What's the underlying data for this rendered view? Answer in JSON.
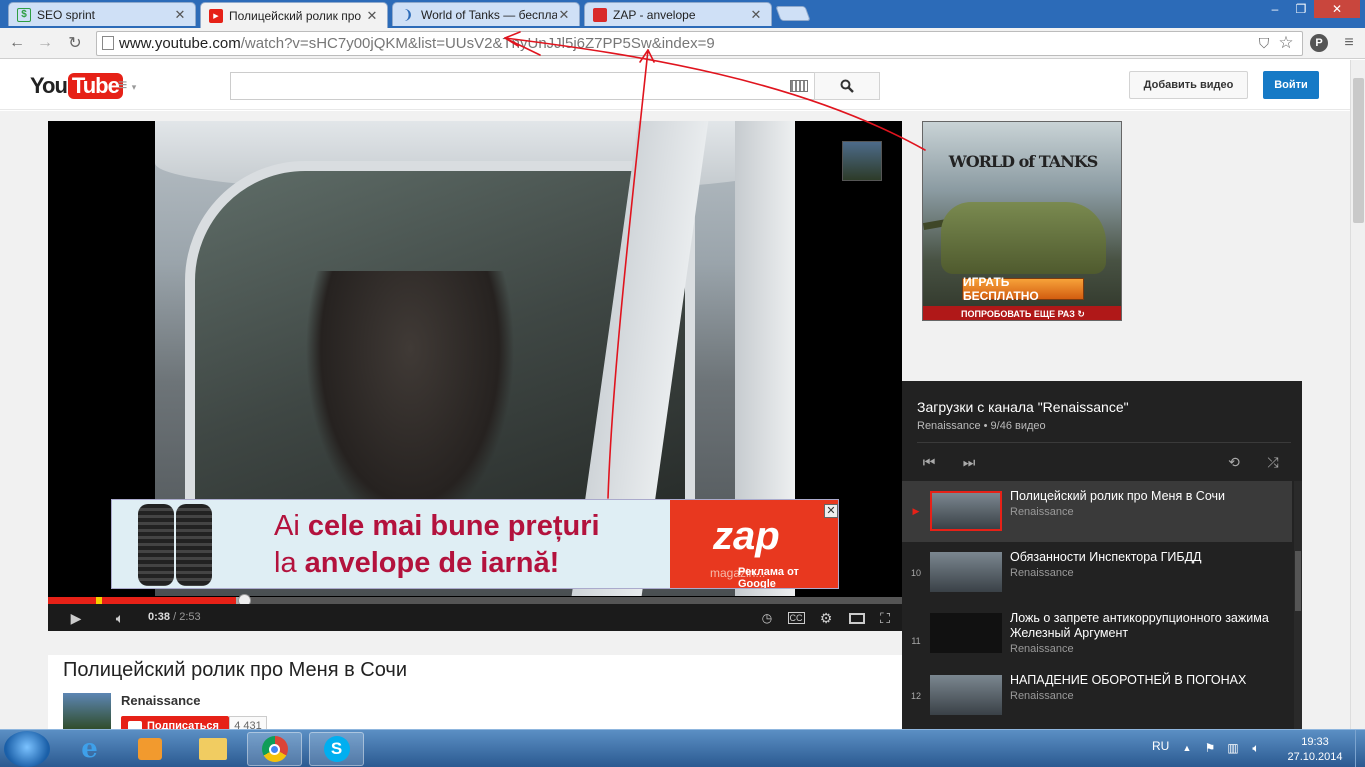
{
  "browser": {
    "tabs": [
      {
        "title": "SEO sprint",
        "favicon": "dollar-icon",
        "color": "#2e9e43"
      },
      {
        "title": "Полицейский ролик про",
        "favicon": "youtube-icon",
        "color": "#e62117"
      },
      {
        "title": "World of Tanks — бесплат",
        "favicon": "loading-icon",
        "color": "#2c6bb8"
      },
      {
        "title": "ZAP - anvelope",
        "favicon": "zap-icon",
        "color": "#d92a2a"
      }
    ],
    "url_host": "www.youtube.com",
    "url_path": "/watch?v=sHC7y00jQKM&list=UUsV2&TnyUnJJl5j6Z7PP5Sw&index=9",
    "window_buttons": [
      "–",
      "❐",
      "✕"
    ]
  },
  "youtube": {
    "logo_you": "You",
    "logo_tube": "Tube",
    "upload_label": "Добавить видео",
    "signin_label": "Войти"
  },
  "player": {
    "current_time": "0:38",
    "duration": "2:53",
    "played_fraction": 0.22,
    "buffered_fraction": 0.23,
    "ad": {
      "line1_plain": "Ai ",
      "line1_bold": "cele mai bune prețuri",
      "line2_plain": "la ",
      "line2_bold": "anvelope de iarnă!",
      "brand": "zap",
      "brand_sub": "magazin...",
      "google_label": "Реклама от Google",
      "close": "✕"
    }
  },
  "video": {
    "title": "Полицейский ролик про Меня в Сочи",
    "owner": "Renaissance",
    "subscribe_label": "Подписаться",
    "subscriber_count": "4 431"
  },
  "wot_ad": {
    "logo": "WORLD of TANKS",
    "play_label": "ИГРАТЬ БЕСПЛАТНО",
    "again_label": "ПОПРОБОВАТЬ ЕЩЕ РАЗ ↻"
  },
  "playlist": {
    "title": "Загрузки с канала \"Renaissance\"",
    "subtitle": "Renaissance • 9/46 видео",
    "items": [
      {
        "index": "▶",
        "title": "Полицейский ролик про Меня в Сочи",
        "owner": "Renaissance",
        "active": true
      },
      {
        "index": "10",
        "title": "Обязанности Инспектора ГИБДД",
        "owner": "Renaissance",
        "active": false
      },
      {
        "index": "11",
        "title": "Ложь о запрете антикоррупционного зажима Железный Аргумент",
        "owner": "Renaissance",
        "active": false
      },
      {
        "index": "12",
        "title": "НАПАДЕНИЕ ОБОРОТНЕЙ В ПОГОНАХ",
        "owner": "Renaissance",
        "active": false
      }
    ]
  },
  "taskbar": {
    "lang": "RU",
    "time": "19:33",
    "date": "27.10.2014"
  }
}
